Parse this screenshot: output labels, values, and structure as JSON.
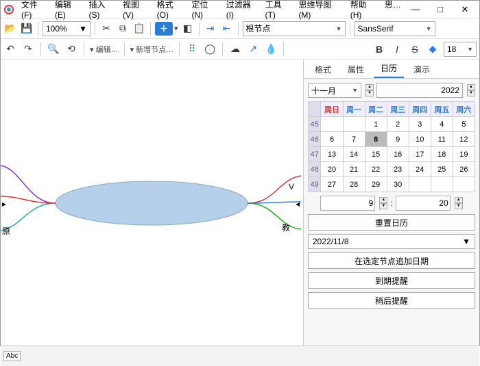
{
  "title_menus": [
    "文件(F)",
    "编辑(E)",
    "插入(S)",
    "视图(V)",
    "格式(O)",
    "定位(N)",
    "过滤器(I)",
    "工具(T)",
    "思维导图(M)",
    "帮助(H)",
    "思…"
  ],
  "window": {
    "min": "—",
    "max": "□",
    "close": "✕"
  },
  "toolbar": {
    "zoom": "100%",
    "root_combo": "根节点",
    "font_combo": "SansSerif",
    "edit_label": "▾ 编辑…",
    "newnode_label": "▾ 新增节点…",
    "fontsize": "18"
  },
  "canvas": {
    "left_label": "原",
    "right_top": "V",
    "right_bot": "教"
  },
  "tabs": [
    "格式",
    "属性",
    "日历",
    "演示"
  ],
  "active_tab": 2,
  "calendar": {
    "month": "十一月",
    "year": "2022",
    "weekdays": [
      "周日",
      "周一",
      "周二",
      "周三",
      "周四",
      "周五",
      "周六"
    ],
    "weeks": [
      {
        "wk": "45",
        "days": [
          "",
          "",
          "1",
          "2",
          "3",
          "4",
          "5"
        ]
      },
      {
        "wk": "46",
        "days": [
          "6",
          "7",
          "8",
          "9",
          "10",
          "11",
          "12"
        ]
      },
      {
        "wk": "47",
        "days": [
          "13",
          "14",
          "15",
          "16",
          "17",
          "18",
          "19"
        ]
      },
      {
        "wk": "48",
        "days": [
          "20",
          "21",
          "22",
          "23",
          "24",
          "25",
          "26"
        ]
      },
      {
        "wk": "49",
        "days": [
          "27",
          "28",
          "29",
          "30",
          "",
          "",
          ""
        ]
      }
    ],
    "selected": "8",
    "hour": "9",
    "minute": "20",
    "reset_btn": "重置日历",
    "date_value": "2022/11/8",
    "add_btn": "在选定节点追加日期",
    "due_btn": "到期提醒",
    "later_btn": "稍后提醒"
  },
  "status": {
    "abc": "Abc"
  }
}
